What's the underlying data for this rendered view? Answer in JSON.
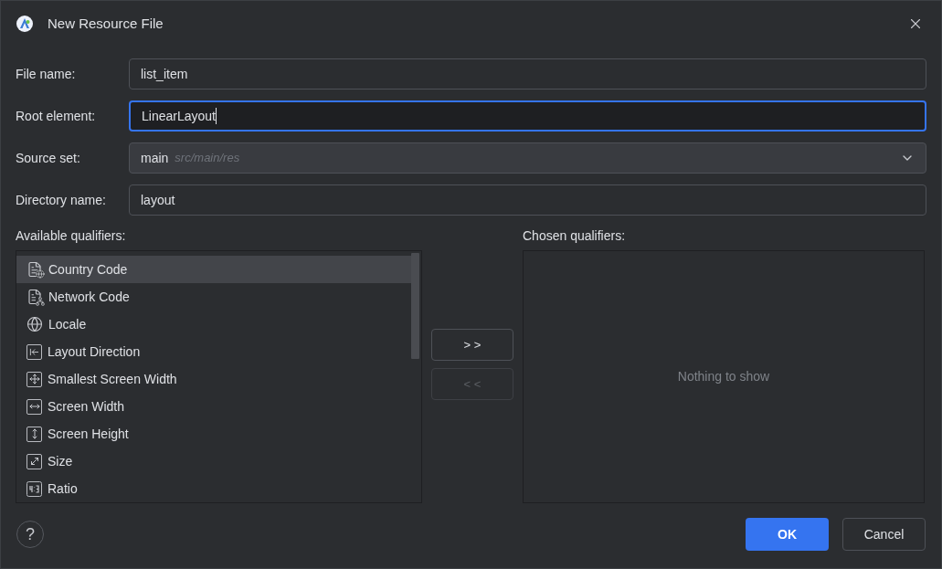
{
  "window": {
    "title": "New Resource File"
  },
  "fields": [
    {
      "kind": "text",
      "label": "File name:",
      "value": "list_item",
      "focused": false
    },
    {
      "kind": "text",
      "label": "Root element:",
      "value": "LinearLayout",
      "focused": true
    },
    {
      "kind": "dropdown",
      "label": "Source set:",
      "value": "main",
      "hint": "src/main/res",
      "focused": false
    },
    {
      "kind": "text",
      "label": "Directory name:",
      "value": "layout",
      "focused": false
    }
  ],
  "available": {
    "label": "Available qualifiers:",
    "items": [
      {
        "kind": "country",
        "label": "Country Code",
        "selected": true
      },
      {
        "kind": "network",
        "label": "Network Code",
        "selected": false
      },
      {
        "kind": "locale",
        "label": "Locale",
        "selected": false
      },
      {
        "kind": "direction",
        "label": "Layout Direction",
        "selected": false
      },
      {
        "kind": "smallest",
        "label": "Smallest Screen Width",
        "selected": false
      },
      {
        "kind": "width",
        "label": "Screen Width",
        "selected": false
      },
      {
        "kind": "height",
        "label": "Screen Height",
        "selected": false
      },
      {
        "kind": "size",
        "label": "Size",
        "selected": false
      },
      {
        "kind": "ratio",
        "label": "Ratio",
        "selected": false
      }
    ]
  },
  "transfer": [
    {
      "label": "> >",
      "disabled": false
    },
    {
      "label": "< <",
      "disabled": true
    }
  ],
  "chosen": {
    "label": "Chosen qualifiers:",
    "empty": "Nothing to show"
  },
  "help": {
    "label": "?"
  },
  "buttons": [
    {
      "label": "OK",
      "kind": "primary"
    },
    {
      "label": "Cancel",
      "kind": "secondary"
    }
  ]
}
